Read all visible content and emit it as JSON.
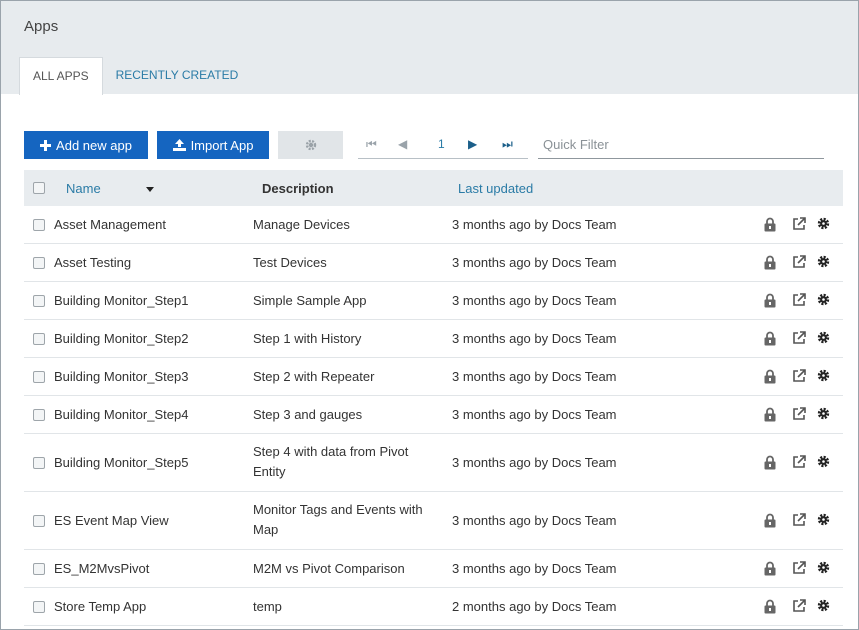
{
  "page": {
    "title": "Apps"
  },
  "tabs": [
    {
      "label": "ALL APPS",
      "active": true
    },
    {
      "label": "RECENTLY CREATED",
      "active": false
    }
  ],
  "toolbar": {
    "add_label": "Add new app",
    "import_label": "Import App",
    "add_icon": "plus-icon",
    "import_icon": "upload-icon",
    "settings_icon": "gear-icon"
  },
  "pager": {
    "first": "⏮",
    "prev": "◀",
    "page": "1",
    "next": "▶",
    "last": "⏭"
  },
  "filter": {
    "placeholder": "Quick Filter",
    "value": ""
  },
  "table": {
    "headers": {
      "name": "Name",
      "description": "Description",
      "updated": "Last updated"
    },
    "sort": {
      "column": "Name",
      "direction": "descending"
    },
    "rows": [
      {
        "name": "Asset Management",
        "description": "Manage Devices",
        "updated": "3 months ago by Docs Team"
      },
      {
        "name": "Asset Testing",
        "description": "Test Devices",
        "updated": "3 months ago by Docs Team"
      },
      {
        "name": "Building Monitor_Step1",
        "description": "Simple Sample App",
        "updated": "3 months ago by Docs Team"
      },
      {
        "name": "Building Monitor_Step2",
        "description": "Step 1 with History",
        "updated": "3 months ago by Docs Team"
      },
      {
        "name": "Building Monitor_Step3",
        "description": "Step 2 with Repeater",
        "updated": "3 months ago by Docs Team"
      },
      {
        "name": "Building Monitor_Step4",
        "description": "Step 3 and gauges",
        "updated": "3 months ago by Docs Team"
      },
      {
        "name": "Building Monitor_Step5",
        "description": "Step 4 with data from Pivot Entity",
        "updated": "3 months ago by Docs Team"
      },
      {
        "name": "ES Event Map View",
        "description": "Monitor Tags and Events with Map",
        "updated": "3 months ago by Docs Team"
      },
      {
        "name": "ES_M2MvsPivot",
        "description": "M2M vs Pivot Comparison",
        "updated": "3 months ago by Docs Team"
      },
      {
        "name": "Store Temp App",
        "description": "temp",
        "updated": "2 months ago by Docs Team"
      }
    ],
    "row_icons": [
      "lock-icon",
      "open-external-icon",
      "gear-icon"
    ]
  },
  "colors": {
    "primary_button": "#1565c0",
    "link": "#2a7ba6",
    "header_bg": "#e7ebee"
  }
}
